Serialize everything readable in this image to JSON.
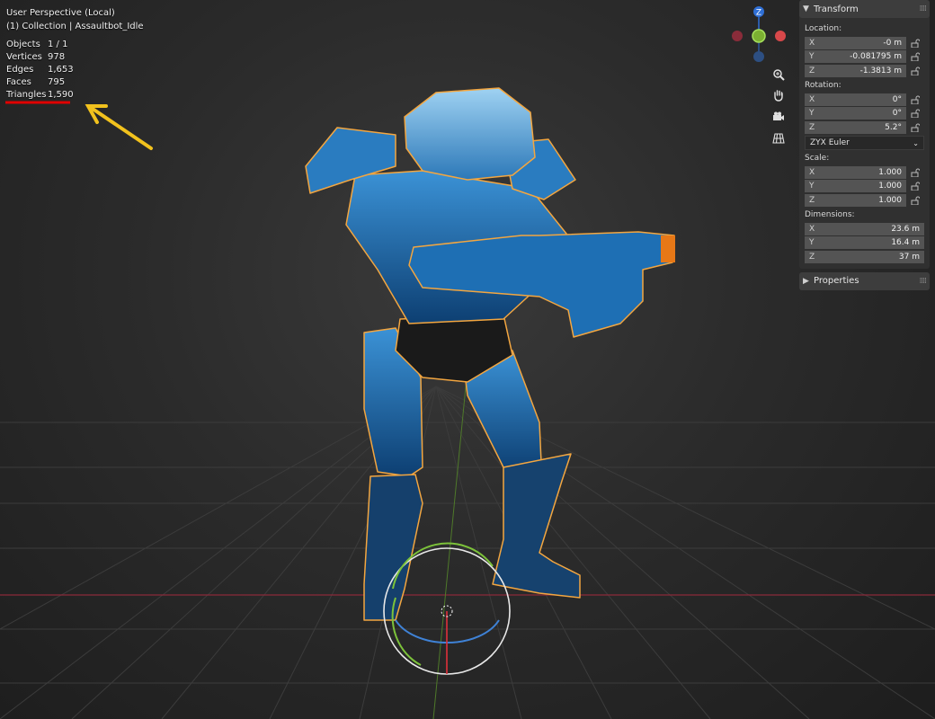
{
  "viewport": {
    "view_name": "User Perspective (Local)",
    "collection": "(1) Collection | Assaultbot_Idle",
    "stats": [
      {
        "label": "Objects",
        "value": "1 / 1"
      },
      {
        "label": "Vertices",
        "value": "978"
      },
      {
        "label": "Edges",
        "value": "1,653"
      },
      {
        "label": "Faces",
        "value": "795"
      },
      {
        "label": "Triangles",
        "value": "1,590"
      }
    ],
    "gizmo": {
      "z_label": "Z"
    }
  },
  "transform": {
    "title": "Transform",
    "location_label": "Location:",
    "location": [
      {
        "axis": "X",
        "value": "-0 m"
      },
      {
        "axis": "Y",
        "value": "-0.081795 m"
      },
      {
        "axis": "Z",
        "value": "-1.3813 m"
      }
    ],
    "rotation_label": "Rotation:",
    "rotation": [
      {
        "axis": "X",
        "value": "0°"
      },
      {
        "axis": "Y",
        "value": "0°"
      },
      {
        "axis": "Z",
        "value": "5.2°"
      }
    ],
    "rotation_mode": "ZYX Euler",
    "scale_label": "Scale:",
    "scale": [
      {
        "axis": "X",
        "value": "1.000"
      },
      {
        "axis": "Y",
        "value": "1.000"
      },
      {
        "axis": "Z",
        "value": "1.000"
      }
    ],
    "dimensions_label": "Dimensions:",
    "dimensions": [
      {
        "axis": "X",
        "value": "23.6 m"
      },
      {
        "axis": "Y",
        "value": "16.4 m"
      },
      {
        "axis": "Z",
        "value": "37 m"
      }
    ]
  },
  "properties": {
    "title": "Properties"
  },
  "colors": {
    "accent_orange": "#f3a640",
    "annotation_arrow": "#f2c21d",
    "underline": "#e00000",
    "robot_blue": "#1f6fb5"
  }
}
